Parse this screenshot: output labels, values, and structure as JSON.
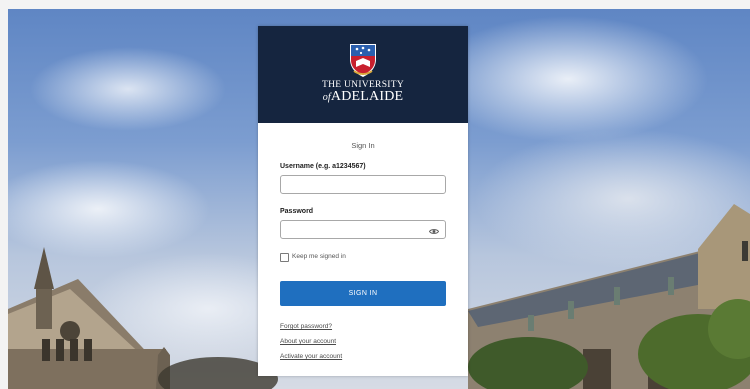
{
  "header": {
    "uni_line1": "THE UNIVERSITY",
    "uni_of": "of",
    "uni_line2": "ADELAIDE"
  },
  "form": {
    "title": "Sign In",
    "username_label": "Username (e.g. a1234567)",
    "username_value": "",
    "password_label": "Password",
    "password_value": "",
    "keep_signed_in_label": "Keep me signed in",
    "keep_signed_in_checked": false,
    "sign_in_button": "SIGN IN"
  },
  "links": {
    "forgot_password": "Forgot password?",
    "about_account": "About your account",
    "activate_account": "Activate your account"
  },
  "icons": {
    "crest": "university-crest-icon",
    "password_toggle": "eye-icon"
  },
  "colors": {
    "header_bg": "#15253f",
    "button_bg": "#1f6fbf",
    "crest_red": "#c8202e",
    "crest_blue": "#2a5fae",
    "crest_gold": "#d9a93a"
  }
}
